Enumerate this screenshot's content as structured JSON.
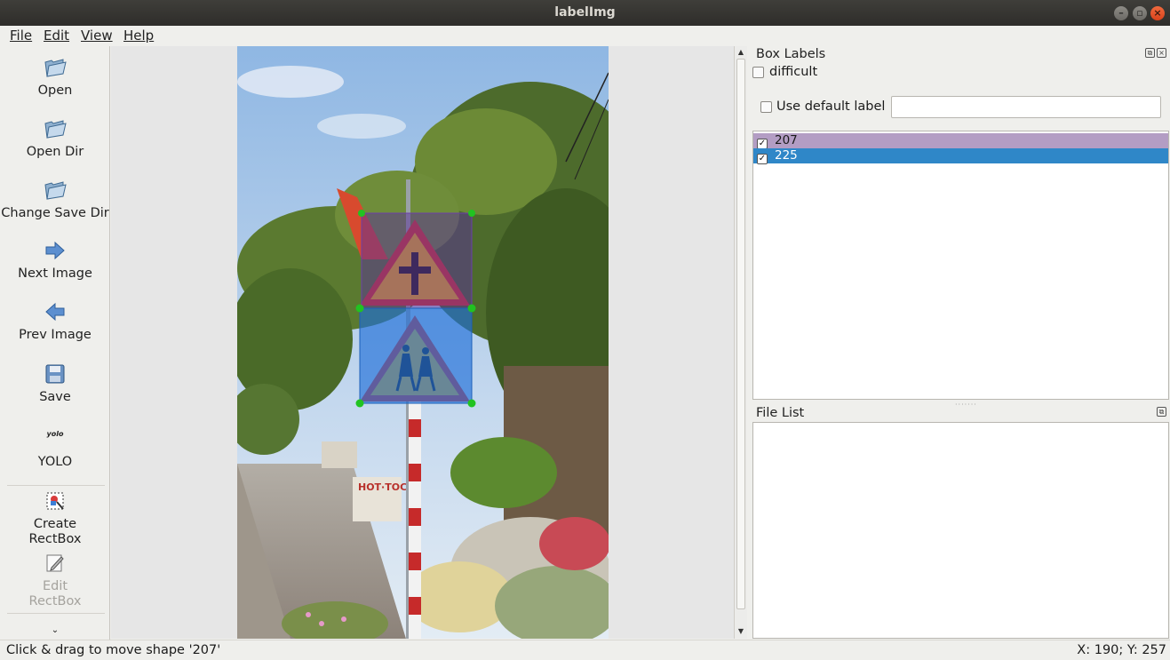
{
  "window": {
    "title": "labelImg"
  },
  "menu": [
    {
      "label": "File"
    },
    {
      "label": "Edit"
    },
    {
      "label": "View"
    },
    {
      "label": "Help"
    }
  ],
  "toolbar": {
    "open": "Open",
    "open_dir": "Open Dir",
    "change_save_dir": "Change Save Dir",
    "next_image": "Next Image",
    "prev_image": "Prev Image",
    "save": "Save",
    "yolo_icon_text": "yolo",
    "yolo": "YOLO",
    "create_rectbox_1": "Create",
    "create_rectbox_2": "RectBox",
    "edit_rectbox_1": "Edit",
    "edit_rectbox_2": "RectBox"
  },
  "box_labels": {
    "title": "Box Labels",
    "difficult": "difficult",
    "use_default_label": "Use default label",
    "default_label_value": "",
    "items": [
      {
        "label": "207",
        "checked": true,
        "color": "#b39dc4"
      },
      {
        "label": "225",
        "checked": true,
        "color": "#2f87c8",
        "selected": true
      }
    ]
  },
  "file_list": {
    "title": "File List",
    "items": []
  },
  "canvas": {
    "shapes": [
      {
        "label": "207",
        "fill": "#6a3f9a"
      },
      {
        "label": "225",
        "fill": "#1f6fd8"
      }
    ]
  },
  "status": {
    "message": "Click & drag to move shape '207'",
    "coords": "X: 190; Y: 257"
  }
}
